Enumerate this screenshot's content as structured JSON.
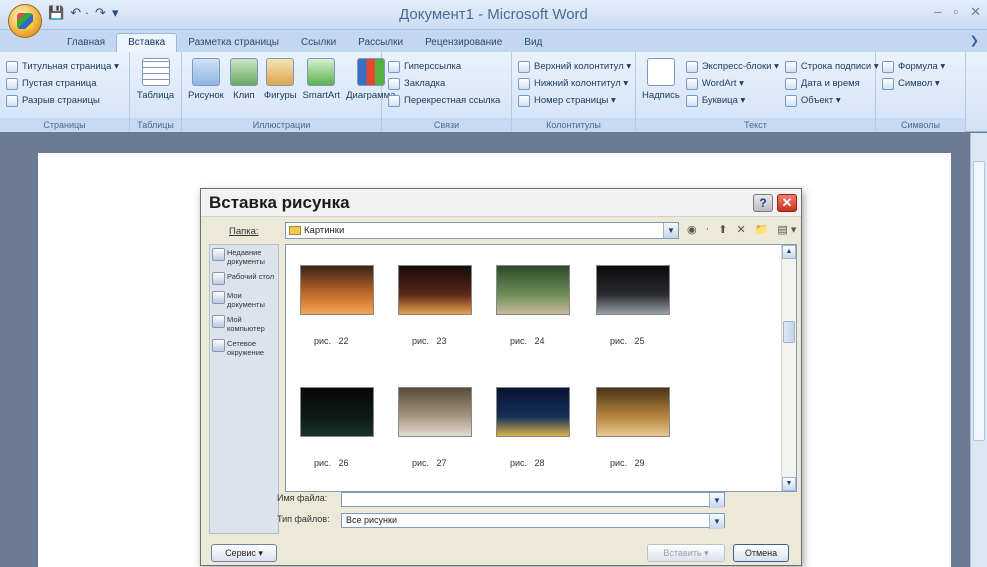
{
  "window": {
    "title": "Документ1 - Microsoft Word",
    "quick_access": [
      "💾",
      "↶ ·",
      "↷",
      "▾"
    ],
    "controls": [
      "–",
      "▫",
      "✕"
    ]
  },
  "ribbon": {
    "tabs": [
      {
        "label": "Главная",
        "active": false
      },
      {
        "label": "Вставка",
        "active": true
      },
      {
        "label": "Разметка страницы",
        "active": false
      },
      {
        "label": "Ссылки",
        "active": false
      },
      {
        "label": "Рассылки",
        "active": false
      },
      {
        "label": "Рецензирование",
        "active": false
      },
      {
        "label": "Вид",
        "active": false
      }
    ],
    "help": "❯",
    "groups": {
      "pages": {
        "label": "Страницы",
        "items": [
          "Титульная страница ▾",
          "Пустая страница",
          "Разрыв страницы"
        ]
      },
      "tables": {
        "label": "Таблицы",
        "button": "Таблица"
      },
      "illustrations": {
        "label": "Иллюстрации",
        "buttons": [
          "Рисунок",
          "Клип",
          "Фигуры",
          "SmartArt",
          "Диаграмма"
        ]
      },
      "links": {
        "label": "Связи",
        "items": [
          "Гиперссылка",
          "Закладка",
          "Перекрестная ссылка"
        ]
      },
      "header_footer": {
        "label": "Колонтитулы",
        "items": [
          "Верхний колонтитул ▾",
          "Нижний колонтитул ▾",
          "Номер страницы ▾"
        ]
      },
      "text": {
        "label": "Текст",
        "button": "Надпись",
        "items": [
          "Экспресс-блоки ▾",
          "WordArt ▾",
          "Буквица ▾",
          "Строка подписи ▾",
          "Дата и время",
          "Объект ▾"
        ]
      },
      "symbols": {
        "label": "Символы",
        "items": [
          "Формула ▾",
          "Символ ▾"
        ]
      }
    }
  },
  "dialog": {
    "title": "Вставка рисунка",
    "help_button": "?",
    "close_button": "✕",
    "look_in_label": "Папка:",
    "look_in_value": "Картинки",
    "toolbar_icons": [
      "◉",
      "·",
      "⬆",
      "✕",
      "📁",
      "▤ ▾"
    ],
    "places": [
      {
        "label": "Недавние документы"
      },
      {
        "label": "Рабочий стол"
      },
      {
        "label": "Мои документы"
      },
      {
        "label": "Мой компьютер"
      },
      {
        "label": "Сетевое окружение"
      }
    ],
    "files": [
      {
        "caption": "рис.   22",
        "colors": [
          "#3a2316",
          "#c46c2a",
          "#f2a650"
        ]
      },
      {
        "caption": "рис.   23",
        "colors": [
          "#140c08",
          "#5c2818",
          "#e8a050"
        ]
      },
      {
        "caption": "рис.   24",
        "colors": [
          "#2b4a2a",
          "#6f8f5a",
          "#c9b99a"
        ]
      },
      {
        "caption": "рис.   25",
        "colors": [
          "#0a0a0c",
          "#2a2c30",
          "#9aa0a8"
        ]
      },
      {
        "caption": "рис.   26",
        "colors": [
          "#060808",
          "#0e1a16",
          "#17342a"
        ]
      },
      {
        "caption": "рис.   27",
        "colors": [
          "#5a4a3a",
          "#a89882",
          "#e4ddd0"
        ]
      },
      {
        "caption": "рис.   28",
        "colors": [
          "#0a1230",
          "#14305a",
          "#d8b24a"
        ]
      },
      {
        "caption": "рис.   29",
        "colors": [
          "#4a3418",
          "#b88640",
          "#e8c890"
        ]
      }
    ],
    "file_name_label": "Имя файла:",
    "file_name_value": "",
    "file_type_label": "Тип файлов:",
    "file_type_value": "Все рисунки",
    "service_button": "Сервис",
    "insert_button": "Вставить",
    "cancel_button": "Отмена"
  }
}
